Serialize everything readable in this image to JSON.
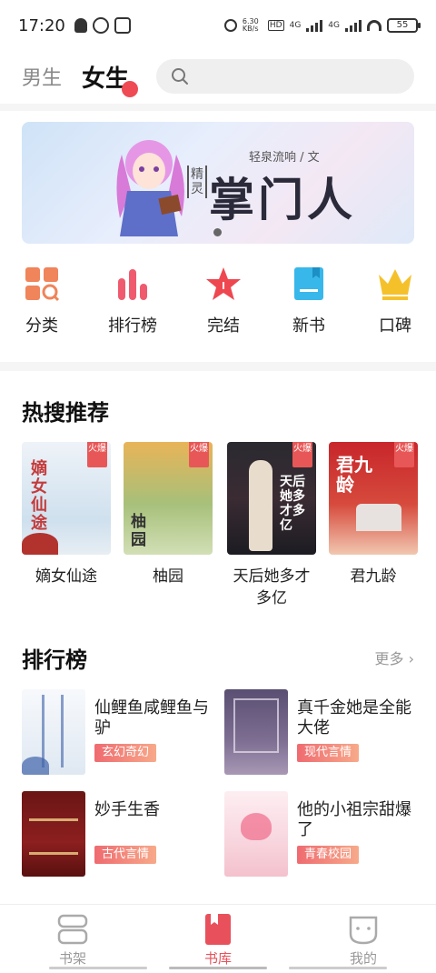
{
  "status_bar": {
    "time": "17:20",
    "net_speed": "6.30\nKB/s",
    "hd": "HD",
    "signal1": "4G",
    "signal2": "4G",
    "battery": "55"
  },
  "top_nav": {
    "tab_male": "男生",
    "tab_female": "女生",
    "search_placeholder": ""
  },
  "banner": {
    "author": "轻泉流响 / 文",
    "tag": "精灵",
    "title": "掌门人"
  },
  "categories": [
    {
      "label": "分类",
      "icon": "category-icon",
      "color": "#f0845a"
    },
    {
      "label": "排行榜",
      "icon": "ranking-icon",
      "color": "#ef5a6e"
    },
    {
      "label": "完结",
      "icon": "star-icon",
      "color": "#ee4750"
    },
    {
      "label": "新书",
      "icon": "book-icon",
      "color": "#38b7ea"
    },
    {
      "label": "口碑",
      "icon": "crown-icon",
      "color": "#f5c12b"
    }
  ],
  "hot_section": {
    "title": "热搜推荐",
    "hot_tag": "火爆",
    "books": [
      {
        "title": "嫡女仙途",
        "cover_text": "嫡女仙途"
      },
      {
        "title": "柚园",
        "cover_text": "柚园"
      },
      {
        "title": "天后她多才多亿",
        "cover_text": "天后她多才多亿"
      },
      {
        "title": "君九龄",
        "cover_text": "君九龄"
      }
    ]
  },
  "rank_section": {
    "title": "排行榜",
    "more": "更多 ›",
    "items": [
      {
        "title": "仙鲤鱼咸鲤鱼与驴",
        "tag": "玄幻奇幻"
      },
      {
        "title": "真千金她是全能大佬",
        "tag": "现代言情"
      },
      {
        "title": "妙手生香",
        "tag": "古代言情"
      },
      {
        "title": "他的小祖宗甜爆了",
        "tag": "青春校园"
      }
    ]
  },
  "bottom_nav": [
    {
      "label": "书架",
      "icon": "bookshelf-icon",
      "active": false
    },
    {
      "label": "书库",
      "icon": "library-icon",
      "active": true
    },
    {
      "label": "我的",
      "icon": "profile-icon",
      "active": false
    }
  ],
  "colors": {
    "accent": "#e8515b",
    "hot_tag": "#e85757"
  }
}
